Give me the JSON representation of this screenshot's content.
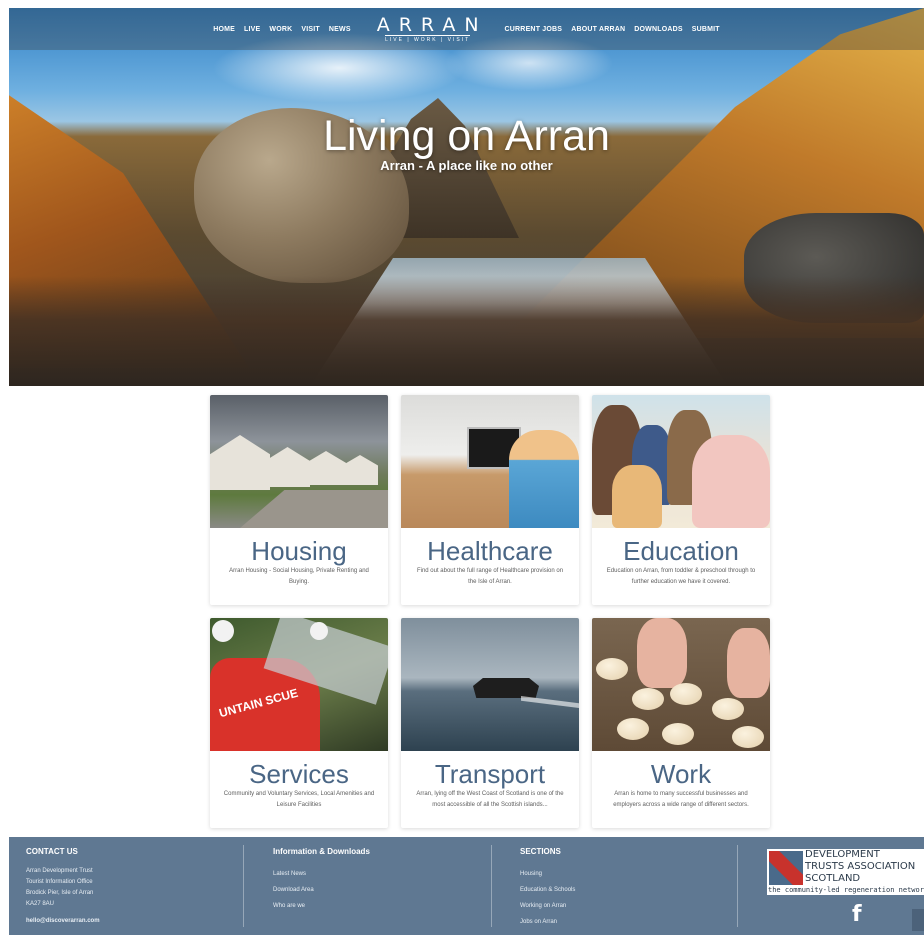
{
  "nav": {
    "left_links": [
      "HOME",
      "LIVE",
      "WORK",
      "VISIT",
      "NEWS"
    ],
    "logo_word": "ARRAN",
    "logo_tagline": "LIVE | WORK | VISIT",
    "right_links": [
      "CURRENT JOBS",
      "ABOUT ARRAN",
      "DOWNLOADS",
      "SUBMIT"
    ]
  },
  "hero": {
    "title": "Living on Arran",
    "subtitle": "Arran - A place like no other"
  },
  "cards": [
    {
      "title": "Housing",
      "desc": "Arran Housing - Social Housing, Private Renting and Buying."
    },
    {
      "title": "Healthcare",
      "desc": "Find out about the full range of Healthcare provision on the Isle of Arran."
    },
    {
      "title": "Education",
      "desc": "Education on Arran, from toddler & preschool through to further education we have it covered."
    },
    {
      "title": "Services",
      "desc": "Community and Voluntary Services, Local Amenities and Leisure Facilities",
      "image_text": "UNTAIN SCUE"
    },
    {
      "title": "Transport",
      "desc": "Arran, lying off the West Coast of Scotland is one of the most accessible of all the Scottish islands..."
    },
    {
      "title": "Work",
      "desc": "Arran is home to many successful businesses and employers across a wide range of different sectors."
    }
  ],
  "footer": {
    "contact": {
      "heading": "CONTACT US",
      "lines": [
        "Arran Development Trust",
        "Tourist Information Office",
        "Brodick Pier, Isle of Arran",
        "KA27 8AU"
      ],
      "email": "hello@discoverarran.com"
    },
    "info": {
      "heading": "Information & Downloads",
      "items": [
        "Latest News",
        "Download Area",
        "Who are we"
      ]
    },
    "sections": {
      "heading": "SECTIONS",
      "items": [
        "Housing",
        "Education & Schools",
        "Working on Arran",
        "Jobs on Arran"
      ]
    },
    "partner": {
      "line1": "DEVELOPMENT",
      "line2": "TRUSTS ASSOCIATION",
      "line3": "SCOTLAND",
      "tagline": "the community-led regeneration network"
    },
    "social": "f"
  },
  "icons": [
    "facebook-icon",
    "dtas-logo-icon"
  ],
  "colors": {
    "accent": "#4a6685",
    "footer_bg": "#5f7892"
  }
}
